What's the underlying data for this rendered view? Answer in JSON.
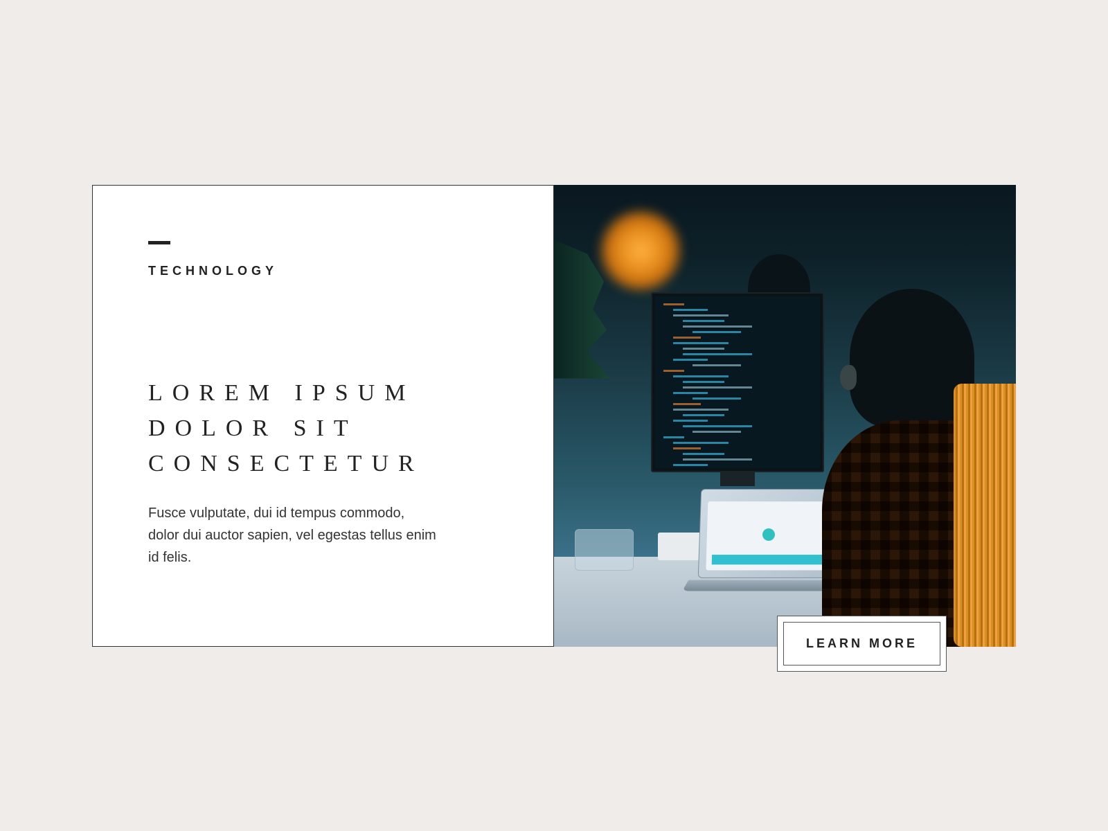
{
  "card": {
    "category": "TECHNOLOGY",
    "headline": "LOREM IPSUM DOLOR SIT CONSECTETUR",
    "body": "Fusce vulputate, dui id tempus commodo, dolor dui auctor sapien, vel egestas tellus enim id felis.",
    "cta_label": "LEARN MORE"
  },
  "colors": {
    "page_bg": "#efecea",
    "panel_bg": "#ffffff",
    "text_primary": "#222222",
    "border": "#333333"
  }
}
